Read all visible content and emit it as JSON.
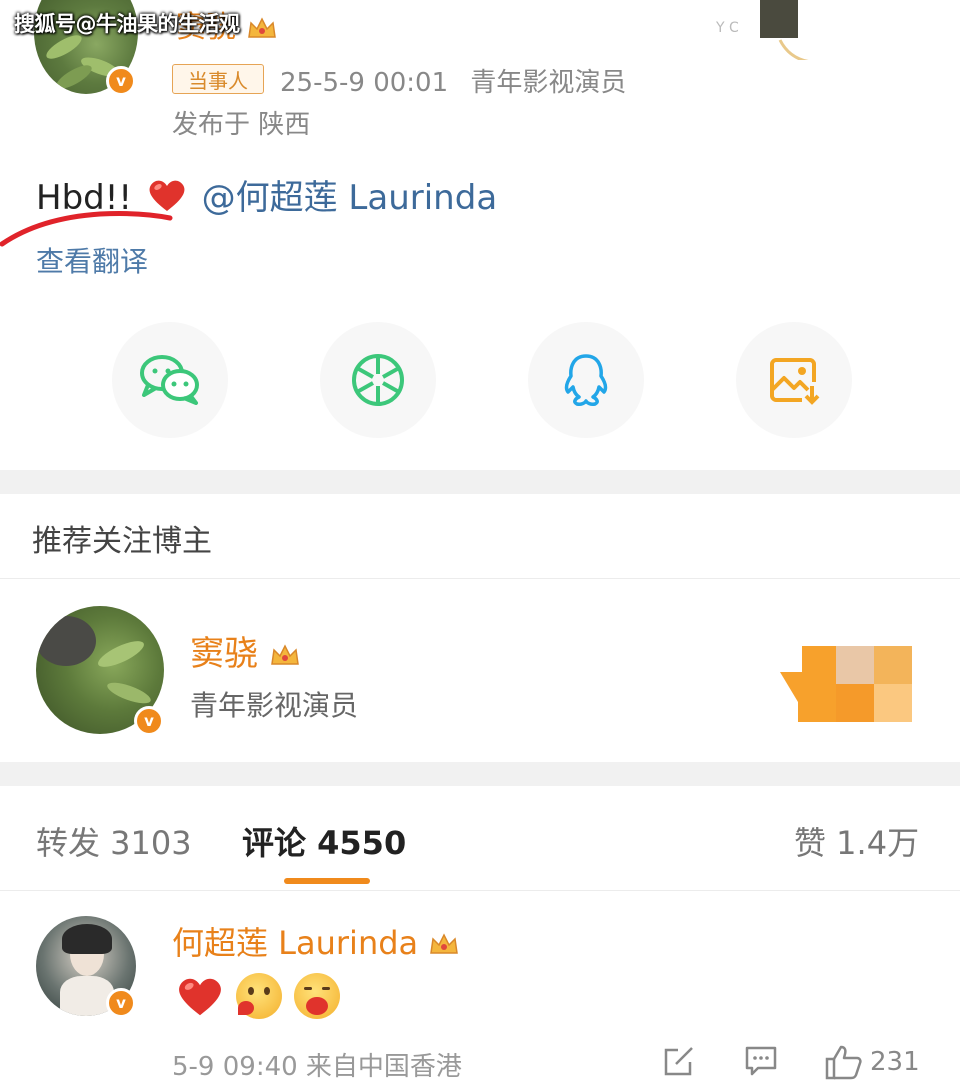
{
  "watermark": "搜狐号@牛油果的生活观",
  "post": {
    "author_name": "窦骁",
    "author_badge": "当事人",
    "timestamp": "25-5-9 00:01",
    "author_title": "青年影视演员",
    "location": "发布于 陕西",
    "text_prefix": "Hbd!!",
    "mention": "@何超莲 Laurinda",
    "translate_label": "查看翻译"
  },
  "share": {
    "items": [
      {
        "name": "wechat-icon",
        "color": "#3cc77a"
      },
      {
        "name": "moments-icon",
        "color": "#3cc77a"
      },
      {
        "name": "qq-icon",
        "color": "#22a6e8"
      },
      {
        "name": "save-image-icon",
        "color": "#f3a623"
      }
    ]
  },
  "recommend": {
    "section_title": "推荐关注博主",
    "name": "窦骁",
    "desc": "青年影视演员"
  },
  "tabs": {
    "repost": "转发 3103",
    "comment": "评论 4550",
    "like": "赞 1.4万"
  },
  "comment": {
    "author": "何超莲 Laurinda",
    "meta": "5-9 09:40 来自中国香港",
    "like_count": "231"
  },
  "colors": {
    "brand_orange": "#e8811a",
    "link_blue": "#3d6a9a",
    "accent": "#f08a1c"
  }
}
